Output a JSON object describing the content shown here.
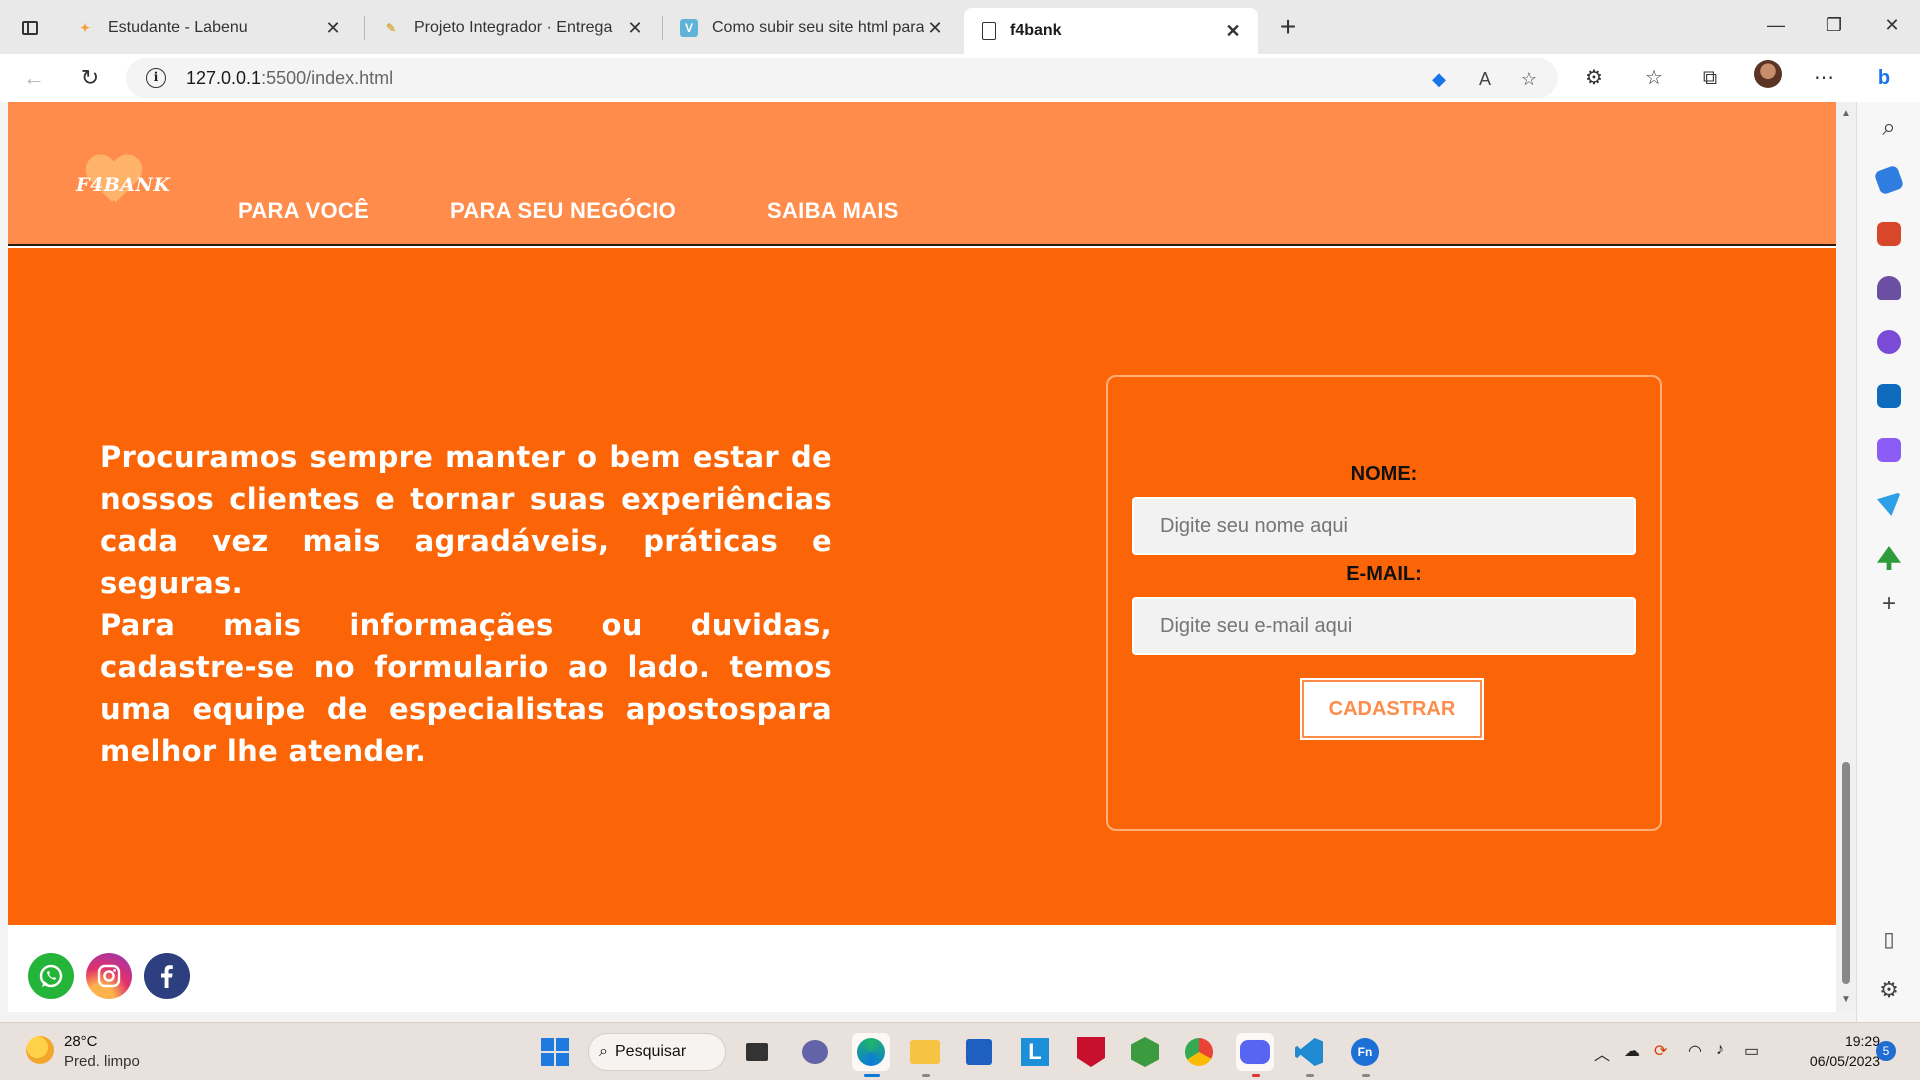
{
  "browser": {
    "tabs": [
      {
        "title": "Estudante - Labenu",
        "icon": "labenu-favicon",
        "active": false
      },
      {
        "title": "Projeto Integrador · Entrega",
        "icon": "notion-favicon",
        "active": false
      },
      {
        "title": "Como subir seu site html para a",
        "icon": "vimeo-favicon",
        "active": false
      },
      {
        "title": "f4bank",
        "icon": "document-favicon",
        "active": true
      }
    ],
    "url_host": "127.0.0.1",
    "url_path": ":5500/index.html"
  },
  "site": {
    "logo_text": "F4BANK",
    "nav": [
      "PARA VOCÊ",
      "PARA SEU NEGÓCIO",
      "SAIBA MAIS"
    ],
    "hero_paragraphs": [
      "Procuramos sempre manter o bem estar de nossos clientes e tornar suas experiências cada vez mais agradáveis, práticas e seguras.",
      "Para mais informaçães ou duvidas, cadastre-se no formulario ao lado. temos uma equipe de especialistas apostospara melhor lhe atender."
    ],
    "form": {
      "name_label": "NOME:",
      "name_placeholder": "Digite seu nome aqui",
      "email_label": "E-MAIL:",
      "email_placeholder": "Digite seu e-mail aqui",
      "submit_label": "CADASTRAR"
    },
    "social": [
      "whatsapp-icon",
      "instagram-icon",
      "facebook-icon"
    ],
    "colors": {
      "header": "#ff8c4a",
      "hero": "#fb6507",
      "accent": "#ff8c4a"
    }
  },
  "taskbar": {
    "weather_temp": "28°C",
    "weather_desc": "Pred. limpo",
    "search_label": "Pesquisar",
    "time": "19:29",
    "date": "06/05/2023",
    "notification_count": "5"
  }
}
